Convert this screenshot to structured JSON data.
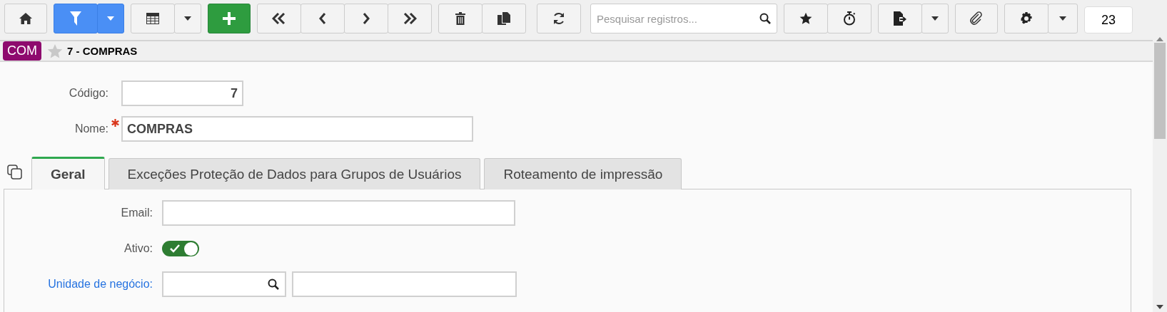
{
  "toolbar": {
    "filter_active": true,
    "search": {
      "placeholder": "Pesquisar registros..."
    },
    "counter": "23"
  },
  "record": {
    "badge": "COM",
    "favorite": false,
    "title": "7 - COMPRAS"
  },
  "fields": [
    {
      "kind": "number",
      "label": "Código:",
      "value": "7",
      "required": false
    },
    {
      "kind": "text",
      "label": "Nome:",
      "value": "COMPRAS",
      "required": true
    }
  ],
  "tabs": [
    {
      "label": "Geral",
      "selected": true
    },
    {
      "label": "Exceções Proteção de Dados para Grupos de Usuários",
      "selected": false
    },
    {
      "label": "Roteamento de impressão",
      "selected": false
    }
  ],
  "tab_fields": [
    {
      "kind": "text",
      "label": "Email:",
      "link": false
    },
    {
      "kind": "toggle",
      "label": "Ativo:",
      "link": false,
      "on": true
    },
    {
      "kind": "lookup",
      "label": "Unidade de negócio:",
      "link": true
    }
  ]
}
